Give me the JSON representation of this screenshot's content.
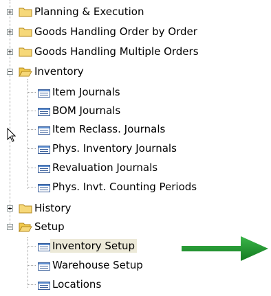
{
  "tree": {
    "top_items": [
      {
        "label": "Planning & Execution",
        "state": "collapsed",
        "icon": "folder-closed-icon"
      },
      {
        "label": "Goods Handling Order by Order",
        "state": "collapsed",
        "icon": "folder-closed-icon"
      },
      {
        "label": "Goods Handling Multiple Orders",
        "state": "collapsed",
        "icon": "folder-closed-icon"
      },
      {
        "label": "Inventory",
        "state": "expanded",
        "icon": "folder-open-icon"
      }
    ],
    "inventory_children": [
      {
        "label": "Item Journals",
        "icon": "form-icon"
      },
      {
        "label": "BOM Journals",
        "icon": "form-icon"
      },
      {
        "label": "Item Reclass. Journals",
        "icon": "form-icon"
      },
      {
        "label": "Phys. Inventory Journals",
        "icon": "form-icon"
      },
      {
        "label": "Revaluation Journals",
        "icon": "form-icon"
      },
      {
        "label": "Phys. Invt. Counting Periods",
        "icon": "form-icon"
      }
    ],
    "history": {
      "label": "History",
      "state": "collapsed",
      "icon": "folder-closed-icon"
    },
    "setup": {
      "label": "Setup",
      "state": "expanded",
      "icon": "folder-open-icon"
    },
    "setup_children": [
      {
        "label": "Inventory Setup",
        "icon": "form-icon",
        "selected": true
      },
      {
        "label": "Warehouse Setup",
        "icon": "form-icon"
      },
      {
        "label": "Locations",
        "icon": "form-icon"
      }
    ]
  },
  "colors": {
    "folder_fill": "#f6d879",
    "folder_stroke": "#b58a1f",
    "form_fill": "#5f8fd0",
    "arrow": "#1f8a2a",
    "selection": "#ece9d8"
  }
}
